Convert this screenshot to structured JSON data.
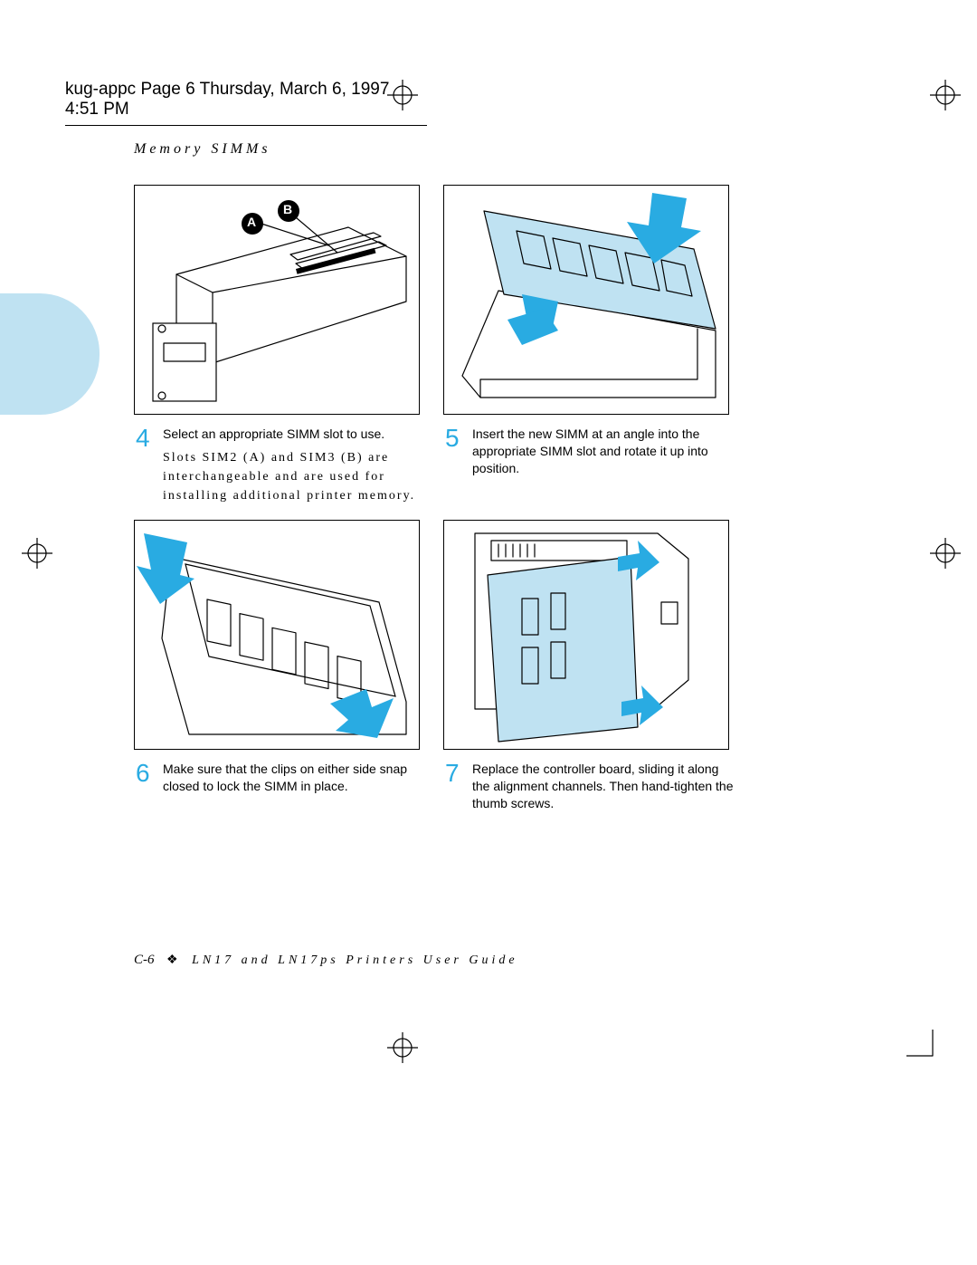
{
  "header": {
    "text": "kug-appc  Page 6  Thursday, March 6, 1997  4:51 PM"
  },
  "section_heading": "Memory SIMMs",
  "labels": {
    "a": "A",
    "b": "B"
  },
  "steps": {
    "s4": {
      "num": "4",
      "text": "Select an appropriate SIMM slot to use.",
      "note": "Slots SIM2 (A) and SIM3 (B) are interchangeable and are used for installing additional printer memory."
    },
    "s5": {
      "num": "5",
      "text": "Insert the new SIMM at an angle into the appropriate SIMM slot and rotate it up into position."
    },
    "s6": {
      "num": "6",
      "text": "Make sure that the clips on either side snap closed to lock the SIMM in place."
    },
    "s7": {
      "num": "7",
      "text": "Replace the controller board, sliding it along the alignment channels. Then hand-tighten the thumb screws."
    }
  },
  "footer": {
    "page_num": "C-6",
    "separator": "❖",
    "guide": "LN17 and LN17ps Printers User Guide"
  }
}
